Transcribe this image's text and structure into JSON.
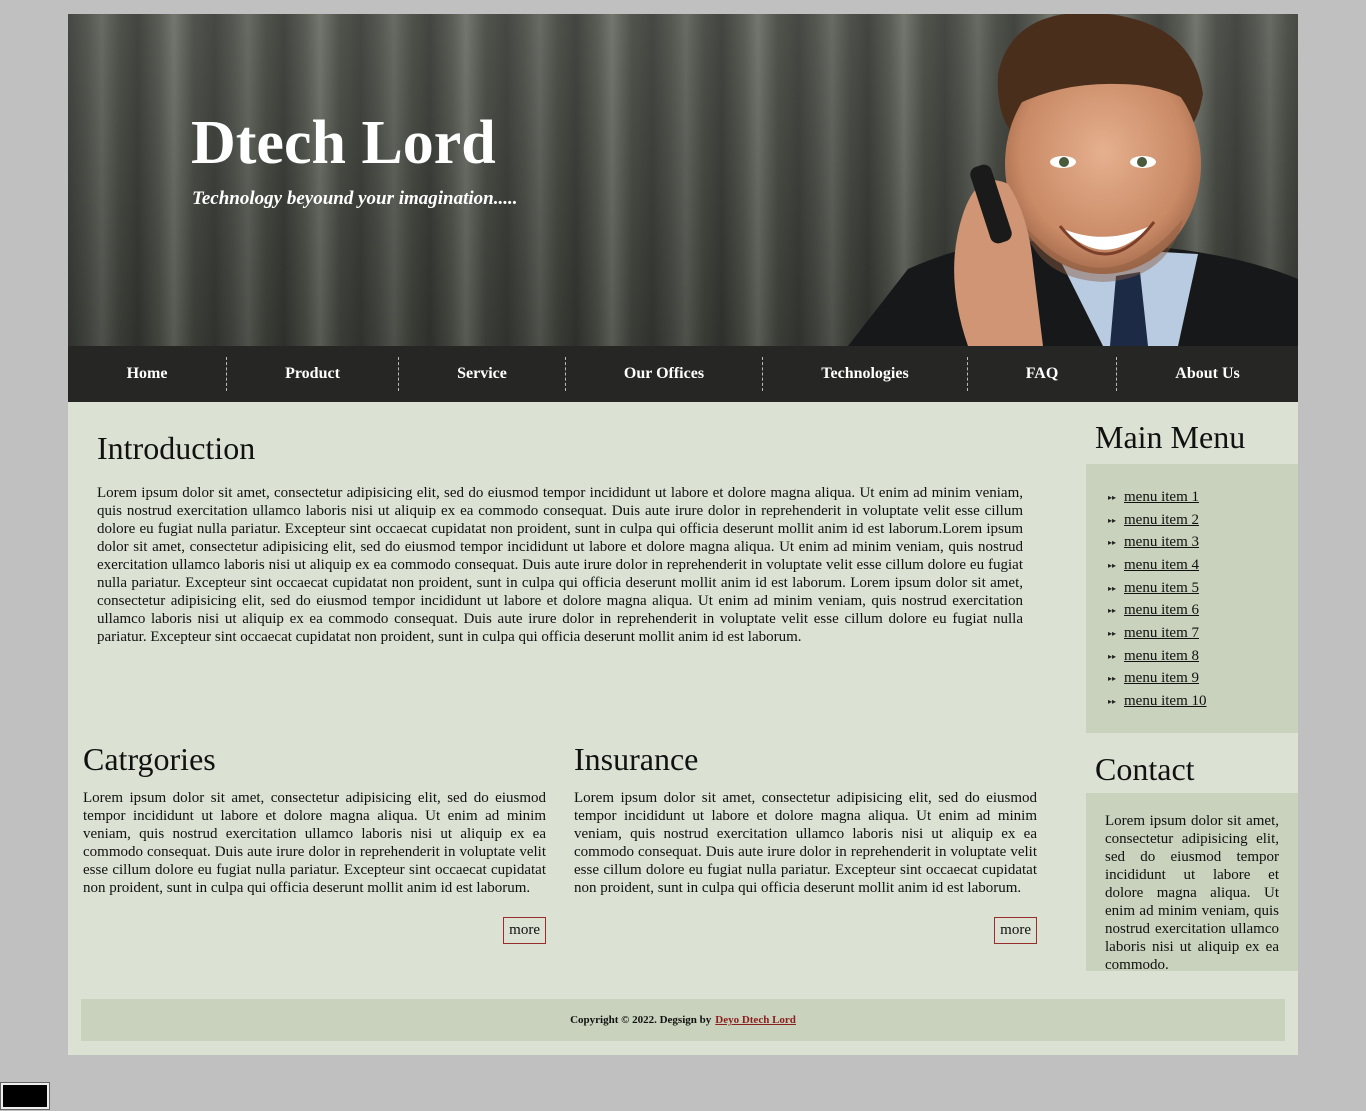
{
  "header": {
    "title": "Dtech Lord",
    "tagline": "Technology beyound your imagination....."
  },
  "nav": {
    "items": [
      "Home",
      "Product",
      "Service",
      "Our Offices",
      "Technologies",
      "FAQ",
      "About Us"
    ]
  },
  "intro": {
    "heading": "Introduction",
    "text": "Lorem ipsum dolor sit amet, consectetur adipisicing elit, sed do eiusmod tempor incididunt ut labore et dolore magna aliqua. Ut enim ad minim veniam, quis nostrud exercitation ullamco laboris nisi ut aliquip ex ea commodo consequat. Duis aute irure dolor in reprehenderit in voluptate velit esse cillum dolore eu fugiat nulla pariatur. Excepteur sint occaecat cupidatat non proident, sunt in culpa qui officia deserunt mollit anim id est laborum.Lorem ipsum dolor sit amet, consectetur adipisicing elit, sed do eiusmod tempor incididunt ut labore et dolore magna aliqua. Ut enim ad minim veniam, quis nostrud exercitation ullamco laboris nisi ut aliquip ex ea commodo consequat. Duis aute irure dolor in reprehenderit in voluptate velit esse cillum dolore eu fugiat nulla pariatur. Excepteur sint occaecat cupidatat non proident, sunt in culpa qui officia deserunt mollit anim id est laborum. Lorem ipsum dolor sit amet, consectetur adipisicing elit, sed do eiusmod tempor incididunt ut labore et dolore magna aliqua. Ut enim ad minim veniam, quis nostrud exercitation ullamco laboris nisi ut aliquip ex ea commodo consequat. Duis aute irure dolor in reprehenderit in voluptate velit esse cillum dolore eu fugiat nulla pariatur. Excepteur sint occaecat cupidatat non proident, sunt in culpa qui officia deserunt mollit anim id est laborum."
  },
  "sidebar": {
    "menu_heading": "Main Menu",
    "menu_items": [
      "menu item 1",
      "menu item 2",
      "menu item 3",
      "menu item 4",
      "menu item 5",
      "menu item 6",
      "menu item 7",
      "menu item 8",
      "menu item 9",
      "menu item 10"
    ],
    "contact_heading": "Contact",
    "contact_text": "Lorem ipsum dolor sit amet, consectetur adipisicing elit, sed do eiusmod tempor incididunt ut labore et dolore magna aliqua. Ut enim ad minim veniam, quis nostrud exercitation ullamco laboris nisi ut aliquip ex ea commodo."
  },
  "categories": {
    "heading": "Catrgories",
    "text": "Lorem ipsum dolor sit amet, consectetur adipisicing elit, sed do eiusmod tempor incididunt ut labore et dolore magna aliqua. Ut enim ad minim veniam, quis nostrud exercitation ullamco laboris nisi ut aliquip ex ea commodo consequat. Duis aute irure dolor in reprehenderit in voluptate velit esse cillum dolore eu fugiat nulla pariatur. Excepteur sint occaecat cupidatat non proident, sunt in culpa qui officia deserunt mollit anim id est laborum.",
    "more_label": "more"
  },
  "insurance": {
    "heading": "Insurance",
    "text": "Lorem ipsum dolor sit amet, consectetur adipisicing elit, sed do eiusmod tempor incididunt ut labore et dolore magna aliqua. Ut enim ad minim veniam, quis nostrud exercitation ullamco laboris nisi ut aliquip ex ea commodo consequat. Duis aute irure dolor in reprehenderit in voluptate velit esse cillum dolore eu fugiat nulla pariatur. Excepteur sint occaecat cupidatat non proident, sunt in culpa qui officia deserunt mollit anim id est laborum.",
    "more_label": "more"
  },
  "footer": {
    "copyright": "Copyright © 2022. Degsign by",
    "link_text": "Deyo Dtech Lord"
  },
  "colors": {
    "page_bg": "#c0c0c0",
    "content_bg": "#dbe1d3",
    "box_bg": "#c9d2bc",
    "nav_bg": "#262624",
    "accent_link": "#8b1e1e"
  }
}
